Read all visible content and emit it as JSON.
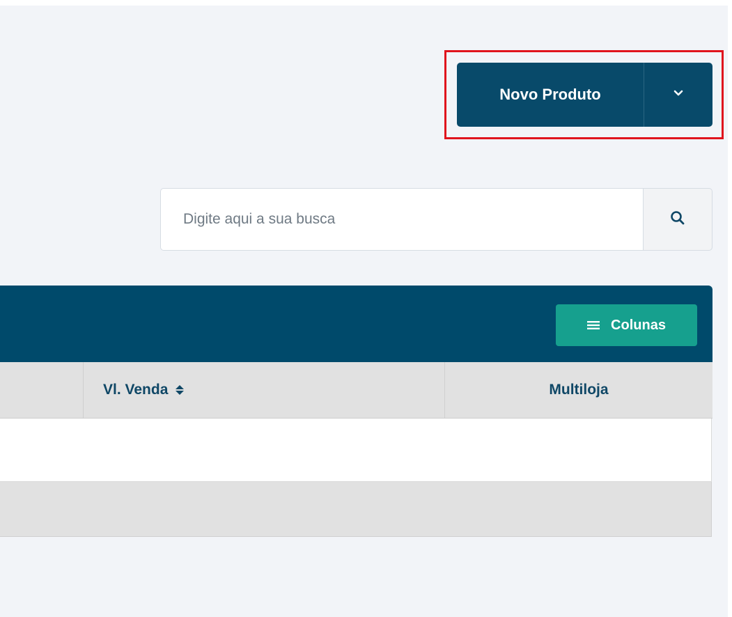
{
  "new_product_button": {
    "label": "Novo Produto",
    "dropdown_icon": "chevron-down-icon"
  },
  "search": {
    "placeholder": "Digite aqui a sua busca",
    "icon": "search-icon"
  },
  "table": {
    "columns_button_label": "Colunas",
    "columns_button_icon": "menu-lines-icon",
    "headers": [
      {
        "label": "Vl. Venda",
        "sortable": true,
        "sort_icon": "sort-updown-icon"
      },
      {
        "label": "Multiloja",
        "sortable": false
      }
    ]
  },
  "colors": {
    "primary": "#084a6a",
    "table_header": "#004a6b",
    "accent_teal": "#16a08e",
    "highlight": "#e0141d",
    "background": "#f2f4f8"
  }
}
